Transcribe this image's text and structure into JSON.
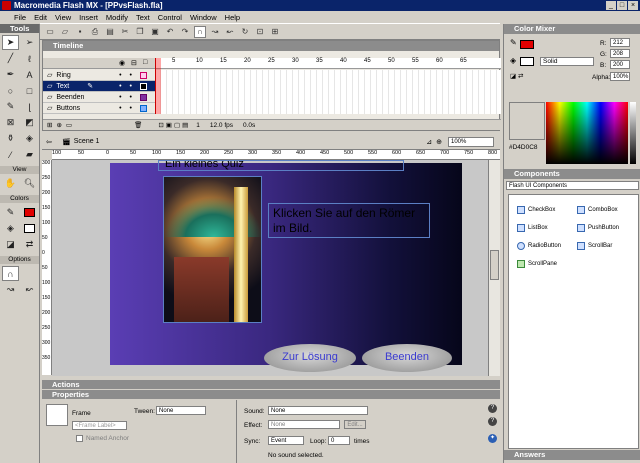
{
  "window": {
    "title": "Macromedia Flash MX - [PPvsFlash.fla]"
  },
  "menu": [
    "File",
    "Edit",
    "View",
    "Insert",
    "Modify",
    "Text",
    "Control",
    "Window",
    "Help"
  ],
  "tools_panel": {
    "title": "Tools",
    "sections": [
      "View",
      "Colors",
      "Options"
    ]
  },
  "timeline": {
    "title": "Timeline",
    "layers": [
      "Ring",
      "Text",
      "Beenden",
      "Buttons"
    ],
    "active_layer": "Text",
    "frame_numbers": [
      "5",
      "10",
      "15",
      "20",
      "25",
      "30",
      "35",
      "40",
      "45",
      "50",
      "55",
      "60",
      "65"
    ],
    "status": {
      "frame": "1",
      "fps": "12.0 fps",
      "time": "0.0s"
    }
  },
  "scene": {
    "label": "Scene 1",
    "zoom": "100%"
  },
  "ruler": [
    "100",
    "50",
    "0",
    "50",
    "100",
    "150",
    "200",
    "250",
    "300",
    "350",
    "400",
    "450",
    "500",
    "550",
    "600",
    "650",
    "700",
    "750",
    "800"
  ],
  "vruler": [
    "300",
    "250",
    "200",
    "150",
    "100",
    "50",
    "0",
    "50",
    "100",
    "150",
    "200",
    "250",
    "300",
    "350"
  ],
  "stage": {
    "header_text": "Ein kleines Quiz",
    "instruction": "Klicken Sie auf  den Römer im Bild.",
    "btn_solution": "Zur Lösung",
    "btn_end": "Beenden"
  },
  "panels": {
    "actions": "Actions",
    "properties": "Properties",
    "answers": "Answers"
  },
  "properties": {
    "type": "Frame",
    "frame_label_placeholder": "<Frame Label>",
    "named_anchor": "Named Anchor",
    "tween_label": "Tween:",
    "tween_value": "None",
    "sound_label": "Sound:",
    "sound_value": "None",
    "effect_label": "Effect:",
    "effect_value": "None",
    "edit_btn": "Edit...",
    "sync_label": "Sync:",
    "sync_value": "Event",
    "loop_label": "Loop:",
    "loop_value": "0",
    "times_label": "times",
    "no_sound": "No sound selected."
  },
  "color_mixer": {
    "title": "Color Mixer",
    "fill_type": "Solid",
    "r": "212",
    "g": "208",
    "b": "200",
    "alpha": "100%",
    "hex": "#D4D0C8",
    "r_label": "R:",
    "g_label": "G:",
    "b_label": "B:",
    "alpha_label": "Alpha:"
  },
  "components": {
    "title": "Components",
    "set": "Flash UI Components",
    "items": [
      "CheckBox",
      "ComboBox",
      "ListBox",
      "PushButton",
      "RadioButton",
      "ScrollBar",
      "ScrollPane"
    ]
  }
}
